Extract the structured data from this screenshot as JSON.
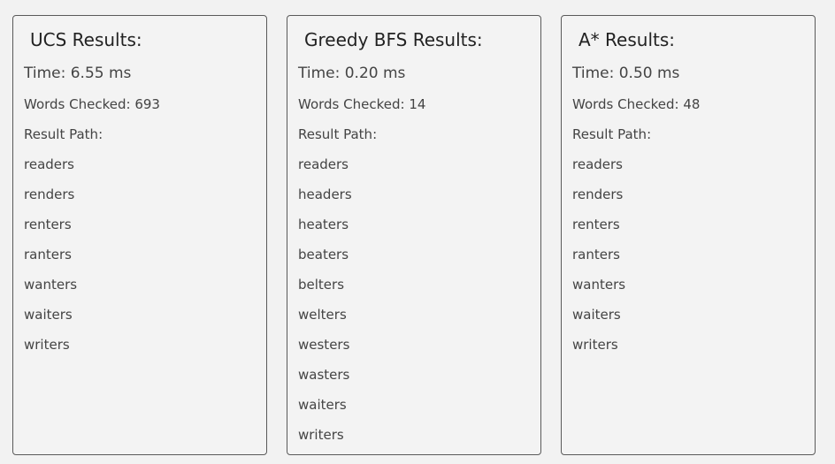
{
  "panels": [
    {
      "title": "UCS Results:",
      "time": "Time: 6.55 ms",
      "words_checked": "Words Checked: 693",
      "result_label": "Result Path:",
      "path": [
        "readers",
        "renders",
        "renters",
        "ranters",
        "wanters",
        "waiters",
        "writers"
      ]
    },
    {
      "title": "Greedy BFS Results:",
      "time": "Time: 0.20 ms",
      "words_checked": "Words Checked: 14",
      "result_label": "Result Path:",
      "path": [
        "readers",
        "headers",
        "heaters",
        "beaters",
        "belters",
        "welters",
        "westers",
        "wasters",
        "waiters",
        "writers"
      ]
    },
    {
      "title": "A* Results:",
      "time": "Time: 0.50 ms",
      "words_checked": "Words Checked: 48",
      "result_label": "Result Path:",
      "path": [
        "readers",
        "renders",
        "renters",
        "ranters",
        "wanters",
        "waiters",
        "writers"
      ]
    }
  ]
}
